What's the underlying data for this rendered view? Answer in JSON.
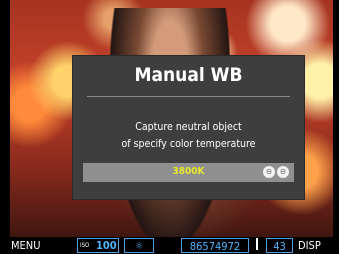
{
  "dialog": {
    "title": "Manual WB",
    "message_line1": "Capture neutral object",
    "message_line2": "of specify color temperature",
    "value": "3800K",
    "arrows": [
      "⊖",
      "⊖"
    ]
  },
  "statusbar": {
    "menu": "MENU",
    "iso_tag": "ISO",
    "iso_value": "100",
    "wb_icon": "☼",
    "counter": "86574972",
    "shots": "43",
    "disp": "DISP"
  },
  "colors": {
    "dialog_bg": "#3e3e3e",
    "value_bar_bg": "#8f8f8f",
    "value_text": "#e6ea2a",
    "status_accent": "#4fb4ff"
  }
}
